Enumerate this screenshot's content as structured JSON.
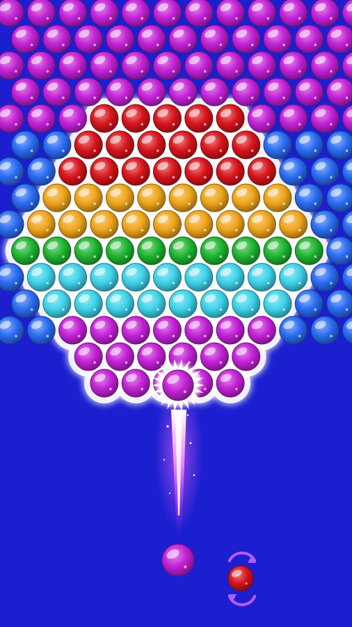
{
  "game": {
    "board": {
      "background_color": "#1c1fcf",
      "rows": [
        {
          "offset": false,
          "cells": [
            "m",
            "m",
            "m",
            "m",
            "m",
            "m",
            "m",
            "m",
            "m",
            "m",
            "m",
            "m"
          ]
        },
        {
          "offset": true,
          "cells": [
            "m",
            "m",
            "m",
            "m",
            "m",
            "m",
            "m",
            "m",
            "m",
            "m",
            "m"
          ]
        },
        {
          "offset": false,
          "cells": [
            "m",
            "m",
            "m",
            "m",
            "m",
            "m",
            "m",
            "m",
            "m",
            "m",
            "m",
            "m"
          ]
        },
        {
          "offset": true,
          "cells": [
            "m",
            "m",
            "m",
            "m",
            "m",
            "m",
            "m",
            "m",
            "m",
            "m",
            "m"
          ]
        },
        {
          "offset": false,
          "cells": [
            "m",
            "m",
            "m",
            "r",
            "r",
            "r",
            "r",
            "r",
            "m",
            "m",
            "m",
            "m"
          ]
        },
        {
          "offset": true,
          "cells": [
            "b",
            "b",
            "r",
            "r",
            "r",
            "r",
            "r",
            "r",
            "b",
            "b",
            "b"
          ]
        },
        {
          "offset": false,
          "cells": [
            "b",
            "b",
            "r",
            "r",
            "r",
            "r",
            "r",
            "r",
            "r",
            "b",
            "b",
            "b"
          ]
        },
        {
          "offset": true,
          "cells": [
            "b",
            "y",
            "y",
            "y",
            "y",
            "y",
            "y",
            "y",
            "y",
            "b",
            "b"
          ]
        },
        {
          "offset": false,
          "cells": [
            "b",
            "y",
            "y",
            "y",
            "y",
            "y",
            "y",
            "y",
            "y",
            "y",
            "b",
            "b"
          ]
        },
        {
          "offset": true,
          "cells": [
            "g",
            "g",
            "g",
            "g",
            "g",
            "g",
            "g",
            "g",
            "g",
            "g",
            "b"
          ]
        },
        {
          "offset": false,
          "cells": [
            "b",
            "c",
            "c",
            "c",
            "c",
            "c",
            "c",
            "c",
            "c",
            "c",
            "b",
            "b"
          ]
        },
        {
          "offset": true,
          "cells": [
            "b",
            "c",
            "c",
            "c",
            "c",
            "c",
            "c",
            "c",
            "c",
            "b",
            "b"
          ]
        },
        {
          "offset": false,
          "cells": [
            "b",
            "b",
            "m",
            "m",
            "m",
            "m",
            "m",
            "m",
            "m",
            "b",
            "b",
            "b"
          ]
        },
        {
          "offset": true,
          "cells": [
            "_",
            "_",
            "m",
            "m",
            "m",
            "m",
            "m",
            "m",
            "_",
            "_",
            "_"
          ]
        },
        {
          "offset": false,
          "cells": [
            "_",
            "_",
            "_",
            "m",
            "m",
            "m",
            "m",
            "m",
            "_",
            "_",
            "_",
            "_"
          ]
        }
      ],
      "hexagon_highlight_color": "#ffffff"
    },
    "colors": {
      "m": {
        "name": "magenta",
        "hex": "#c321d6"
      },
      "b": {
        "name": "blue",
        "hex": "#2a6cf2"
      },
      "r": {
        "name": "red",
        "hex": "#d8141c"
      },
      "y": {
        "name": "yellow",
        "hex": "#f0a51a"
      },
      "g": {
        "name": "green",
        "hex": "#1fb531"
      },
      "c": {
        "name": "cyan",
        "hex": "#3ed3ea"
      }
    },
    "projectile": {
      "color": "m",
      "icon": "burst-bubble-icon"
    },
    "shooter": {
      "current_bubble": "m",
      "next_bubble": "r",
      "swap_icon": "swap-arrows-icon"
    }
  }
}
